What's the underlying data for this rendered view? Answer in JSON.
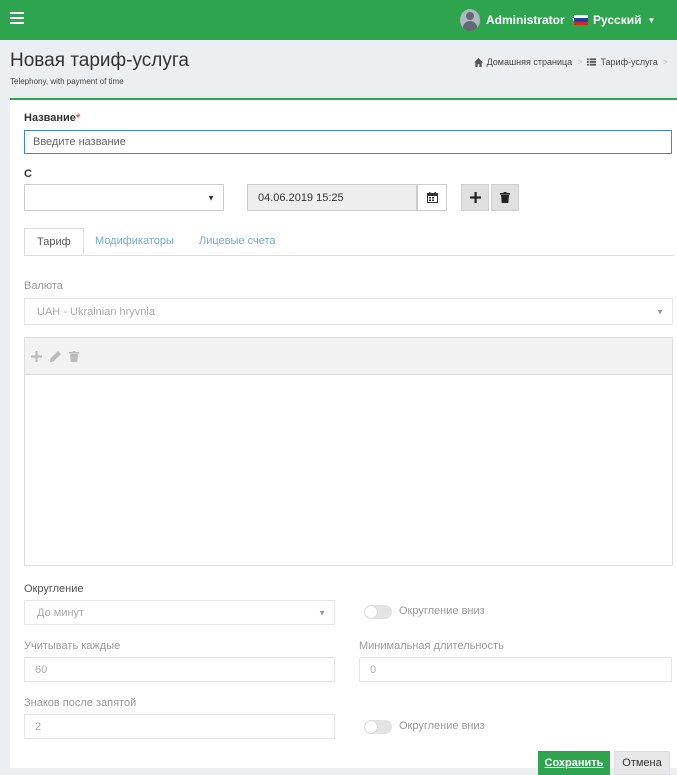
{
  "colors": {
    "brand": "#2ea44f",
    "link": "#72afd2",
    "required": "#d9534f"
  },
  "topbar": {
    "menu_icon": "hamburger-icon",
    "user": {
      "name": "Administrator",
      "icon": "user-avatar"
    },
    "language": {
      "label": "Русский",
      "icon": "russian-flag"
    }
  },
  "header": {
    "title": "Новая тариф-услуга",
    "subtitle": "Telephony, with payment of time",
    "breadcrumb": [
      {
        "label": "Домашняя страница",
        "icon": "home-icon"
      },
      {
        "label": "Тариф-услуга",
        "icon": "list-icon"
      }
    ]
  },
  "form": {
    "name_label": "Название",
    "name_required_mark": "*",
    "name_placeholder": "Введите название",
    "from_label": "С",
    "from_select_value": "",
    "from_date": "04.06.2019 15:25"
  },
  "tabs": [
    {
      "label": "Тариф",
      "active": true
    },
    {
      "label": "Модификаторы",
      "active": false
    },
    {
      "label": "Лицевые счета",
      "active": false
    }
  ],
  "tariff": {
    "currency_label": "Валюта",
    "currency_value": "UAH - Ukrainian hryvnia",
    "rounding_label": "Округление",
    "rounding_value": "До минут",
    "rounding_down_label": "Округление вниз",
    "count_every_label": "Учитывать каждые",
    "count_every_value": "60",
    "min_duration_label": "Минимальная длительность",
    "min_duration_value": "0",
    "decimals_label": "Знаков после запятой",
    "decimals_value": "2",
    "rounding_down2_label": "Округление вниз"
  },
  "actions": {
    "save": "Сохранить",
    "cancel": "Отмена"
  }
}
